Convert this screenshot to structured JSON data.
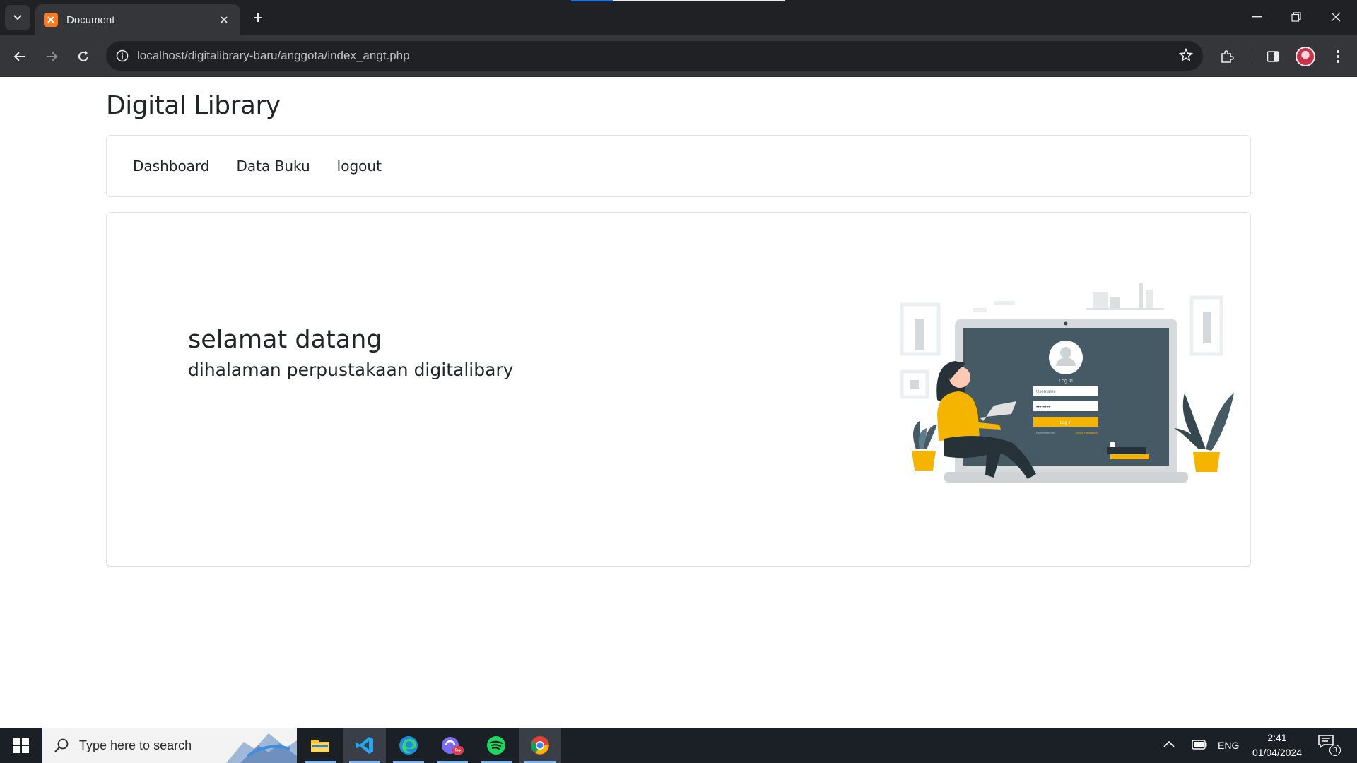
{
  "browser": {
    "tab_title": "Document",
    "url": "localhost/digitalibrary-baru/anggota/index_angt.php"
  },
  "site": {
    "title": "Digital Library",
    "nav": [
      "Dashboard",
      "Data Buku",
      "logout"
    ],
    "hero": {
      "title": "selamat datang",
      "subtitle": "dihalaman perpustakaan digitalibary"
    },
    "illustration": {
      "login_label": "Log In",
      "username_placeholder": "Username",
      "password_mask": "••••••••",
      "login_button": "Log In",
      "remember": "Remember me",
      "forgot": "Forgot Password?"
    }
  },
  "taskbar": {
    "search_placeholder": "Type here to search",
    "language": "ENG",
    "time": "2:41",
    "date": "01/04/2024",
    "notification_count": "3",
    "badge_9plus": "9+"
  },
  "colors": {
    "chrome_dark": "#202124",
    "chrome_toolbar": "#35363a",
    "accent_yellow": "#f5b400",
    "screen_slate": "#455a64"
  }
}
